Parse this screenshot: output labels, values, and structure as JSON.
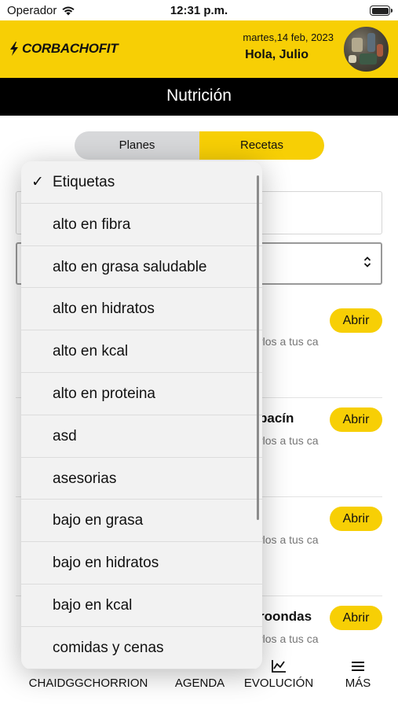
{
  "status_bar": {
    "carrier": "Operador",
    "time": "12:31 p.m.",
    "wifi_icon": "wifi-icon",
    "battery_icon": "battery-icon"
  },
  "header": {
    "logo_text": "CORBACHOFIT",
    "logo_icon": "bolt-icon",
    "date": "martes,14 feb, 2023",
    "greeting": "Hola, Julio",
    "brand_color": "#f7cf05"
  },
  "page_title": "Nutrición",
  "segments": {
    "planes": "Planes",
    "recetas": "Recetas",
    "active": "Recetas"
  },
  "select_chevron_icon": "chevron-updown-icon",
  "recipes": [
    {
      "title": "",
      "desc": "rlos a tus ca",
      "button": "Abrir"
    },
    {
      "title": "pacín",
      "desc": "rlos a tus ca",
      "button": "Abrir"
    },
    {
      "title": "",
      "desc": "rlos a tus ca",
      "button": "Abrir"
    },
    {
      "title": "roondas",
      "desc": "rlos a tus ca",
      "button": "Abrir"
    }
  ],
  "tabbar": {
    "items": [
      {
        "label": "CHAIDGGCHORRION",
        "icon": ""
      },
      {
        "label": "AGENDA",
        "icon": ""
      },
      {
        "label": "EVOLUCIÓN",
        "icon": "chart-line-icon"
      },
      {
        "label": "MÁS",
        "icon": "menu-icon"
      }
    ]
  },
  "dropdown": {
    "selected": "Etiquetas",
    "check_icon": "checkmark-icon",
    "options": [
      "Etiquetas",
      "alto en fibra",
      "alto en grasa saludable",
      "alto en hidratos",
      "alto en kcal",
      "alto en proteina",
      "asd",
      "asesorias",
      "bajo en grasa",
      "bajo en hidratos",
      "bajo en kcal",
      "comidas y cenas"
    ]
  }
}
